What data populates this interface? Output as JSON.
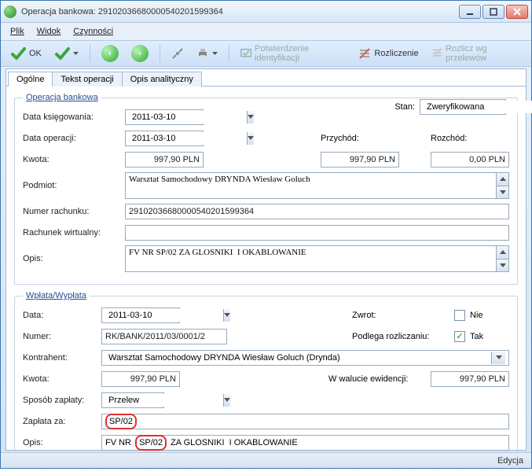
{
  "window": {
    "title": "Operacja bankowa: 29102036680000540201599364"
  },
  "menu": {
    "plik": "Plik",
    "widok": "Widok",
    "czynnosci": "Czynności"
  },
  "toolbar": {
    "ok": "OK",
    "potwierdzenie": "Potwierdzenie identyfikacji",
    "rozliczenie": "Rozliczenie",
    "rozlicz_wg": "Rozlicz wg przelewów"
  },
  "tabs": {
    "ogolne": "Ogólne",
    "tekst": "Tekst operacji",
    "opis": "Opis analityczny"
  },
  "ob": {
    "legend": "Operacja bankowa",
    "stan_label": "Stan:",
    "stan_value": "Zweryfikowana",
    "data_ksieg_label": "Data księgowania:",
    "data_ksieg": "2011-03-10",
    "data_op_label": "Data operacji:",
    "data_op": "2011-03-10",
    "przychod_label": "Przychód:",
    "przychod": "997,90 PLN",
    "rozchod_label": "Rozchód:",
    "rozchod": "0,00 PLN",
    "kwota_label": "Kwota:",
    "kwota": "997,90 PLN",
    "podmiot_label": "Podmiot:",
    "podmiot": "Warsztat Samochodowy DRYNDA Wiesław Goluch",
    "numer_rach_label": "Numer rachunku:",
    "numer_rach": "29102036680000540201599364",
    "rach_wirt_label": "Rachunek wirtualny:",
    "rach_wirt": "",
    "opis_label": "Opis:",
    "opis": "FV NR SP/02 ZA GLOSNIKI  I OKABLOWANIE"
  },
  "ww": {
    "legend": "Wpłata/Wypłata",
    "data_label": "Data:",
    "data": "2011-03-10",
    "zwrot_label": "Zwrot:",
    "zwrot_text": "Nie",
    "numer_label": "Numer:",
    "numer": "RK/BANK/2011/03/0001/2",
    "podlega_label": "Podlega rozliczaniu:",
    "podlega_text": "Tak",
    "kontrahent_label": "Kontrahent:",
    "kontrahent": "Warsztat Samochodowy DRYNDA Wiesław Goluch (Drynda)",
    "kwota_label": "Kwota:",
    "kwota": "997,90 PLN",
    "wwalucie_label": "W walucie ewidencji:",
    "wwalucie": "997,90 PLN",
    "sposob_label": "Sposób zapłaty:",
    "sposob": "Przelew",
    "zaplata_label": "Zapłata za:",
    "zaplata_hl": "SP/02",
    "opis_label": "Opis:",
    "opis_pre": "FV NR ",
    "opis_hl": "SP/02",
    "opis_post": " ZA GLOSNIKI  I OKABLOWANIE"
  },
  "status": {
    "text": "Edycja"
  }
}
